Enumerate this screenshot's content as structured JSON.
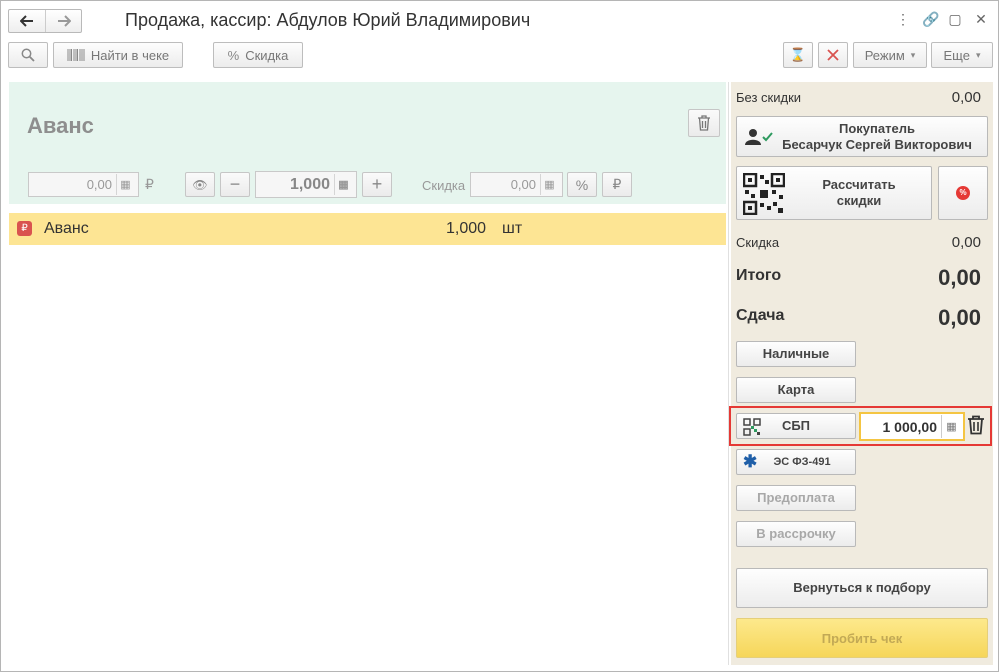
{
  "window": {
    "title": "Продажа, кассир: Абдулов Юрий Владимирович",
    "nav_back": "🡐",
    "nav_forward": "🡒",
    "icons": [
      "more-icon",
      "link-icon",
      "restore-icon",
      "close-icon"
    ]
  },
  "toolbar": {
    "find_in_receipt": "Найти в чеке",
    "discount": "Скидка",
    "mode": "Режим",
    "more": "Еще"
  },
  "item_editor": {
    "title": "Аванс",
    "price": "0,00",
    "currency": "₽",
    "quantity": "1,000",
    "discount_label": "Скидка",
    "discount_value": "0,00",
    "percent_symbol": "%",
    "ruble_symbol": "₽"
  },
  "items": [
    {
      "name": "Аванс",
      "qty": "1,000",
      "unit": "шт"
    }
  ],
  "summary": {
    "no_discount_label": "Без скидки",
    "no_discount_value": "0,00",
    "buyer_label": "Покупатель",
    "buyer_name": "Бесарчук Сергей Викторович",
    "calc_discounts_line1": "Рассчитать",
    "calc_discounts_line2": "скидки",
    "discount_label": "Скидка",
    "discount_value": "0,00",
    "total_label": "Итого",
    "total_value": "0,00",
    "change_label": "Сдача",
    "change_value": "0,00"
  },
  "payments": {
    "cash": "Наличные",
    "card": "Карта",
    "sbp": "СБП",
    "sbp_amount": "1 000,00",
    "es": "ЭС ФЗ-491",
    "prepayment": "Предоплата",
    "installment": "В рассрочку"
  },
  "actions": {
    "return_to_selection": "Вернуться к подбору",
    "print_receipt": "Пробить чек"
  }
}
